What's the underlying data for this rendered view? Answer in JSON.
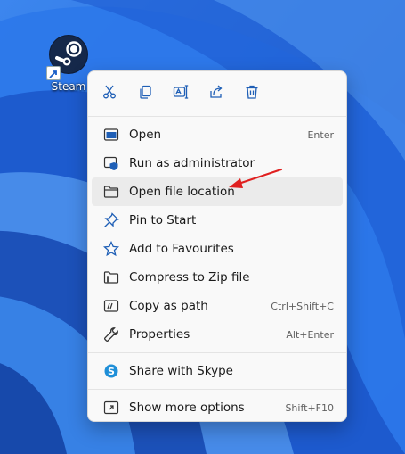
{
  "desktop": {
    "icon_label": "Steam",
    "icon_name": "steam-logo-icon",
    "shortcut_badge_name": "shortcut-arrow-icon"
  },
  "quick_actions": [
    {
      "name": "cut-icon"
    },
    {
      "name": "copy-icon"
    },
    {
      "name": "rename-icon"
    },
    {
      "name": "share-icon"
    },
    {
      "name": "delete-icon"
    }
  ],
  "menu": {
    "items": [
      {
        "label": "Open",
        "shortcut": "Enter",
        "icon": "open-app-icon"
      },
      {
        "label": "Run as administrator",
        "shortcut": "",
        "icon": "shield-icon"
      },
      {
        "label": "Open file location",
        "shortcut": "",
        "icon": "folder-icon"
      },
      {
        "label": "Pin to Start",
        "shortcut": "",
        "icon": "pin-icon"
      },
      {
        "label": "Add to Favourites",
        "shortcut": "",
        "icon": "star-icon"
      },
      {
        "label": "Compress to Zip file",
        "shortcut": "",
        "icon": "zip-folder-icon"
      },
      {
        "label": "Copy as path",
        "shortcut": "Ctrl+Shift+C",
        "icon": "copy-path-icon"
      },
      {
        "label": "Properties",
        "shortcut": "Alt+Enter",
        "icon": "wrench-icon"
      }
    ],
    "extra_items": [
      {
        "label": "Share with Skype",
        "shortcut": "",
        "icon": "skype-icon"
      }
    ],
    "footer_items": [
      {
        "label": "Show more options",
        "shortcut": "Shift+F10",
        "icon": "more-options-icon"
      }
    ]
  },
  "colors": {
    "wallpaper_base": "#2f73e0",
    "menu_bg": "#f9f9f9",
    "hover_bg": "#ebebeb",
    "accent_blue": "#0f6cbd",
    "annotation_arrow": "#e02020"
  }
}
